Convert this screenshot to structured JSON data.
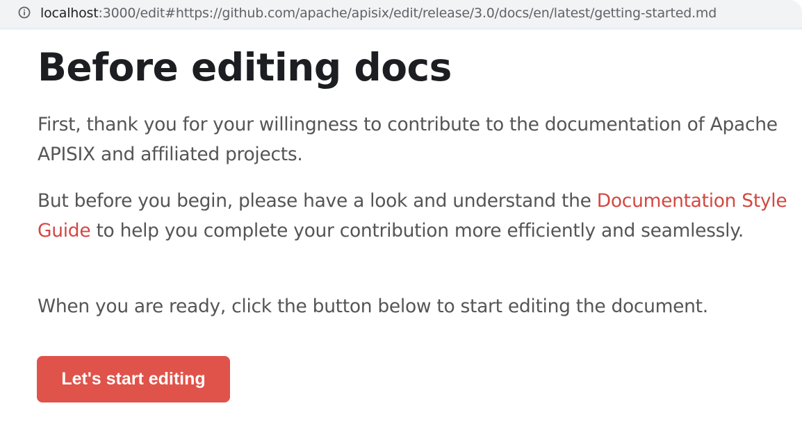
{
  "browser": {
    "url_host": "localhost",
    "url_rest": ":3000/edit#https://github.com/apache/apisix/edit/release/3.0/docs/en/latest/getting-started.md",
    "info_icon": "info-circle-icon"
  },
  "page": {
    "title": "Before editing docs",
    "paragraph1": "First, thank you for your willingness to contribute to the documentation of Apache APISIX and affiliated projects.",
    "paragraph2_before": "But before you begin, please have a look and understand the ",
    "paragraph2_link": "Documentation Style Guide",
    "paragraph2_after": " to help you complete your contribution more efficiently and seamlessly.",
    "paragraph3": "When you are ready, click the button below to start editing the document.",
    "button_label": "Let's start editing"
  },
  "colors": {
    "accent": "#e0534a",
    "link": "#d24841",
    "heading": "#1c1e21",
    "body_text": "#555555"
  }
}
